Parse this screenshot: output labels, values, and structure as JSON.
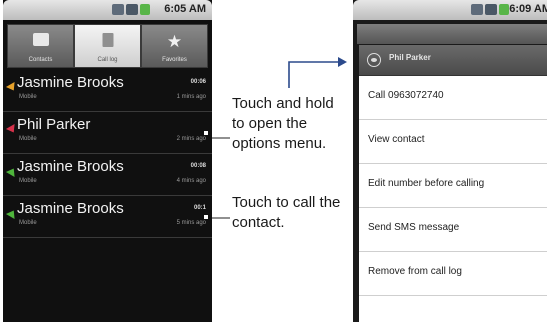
{
  "status": {
    "left_time": "6:05 AM",
    "right_time": "6:09 AM"
  },
  "tabs": [
    {
      "label": "Contacts",
      "icon": "contacts-icon"
    },
    {
      "label": "Call log",
      "icon": "call-log-icon"
    },
    {
      "label": "Favorites",
      "icon": "star-icon"
    }
  ],
  "calls": [
    {
      "name": "Jasmine Brooks",
      "type": "Mobile",
      "duration": "00:06",
      "ago": "1 mins ago",
      "indicator": "incoming"
    },
    {
      "name": "Phil Parker",
      "type": "Mobile",
      "duration": "",
      "ago": "2 mins ago",
      "indicator": "missed"
    },
    {
      "name": "Jasmine Brooks",
      "type": "Mobile",
      "duration": "00:08",
      "ago": "4 mins ago",
      "indicator": "outgoing"
    },
    {
      "name": "Jasmine Brooks",
      "type": "Mobile",
      "duration": "00:1",
      "ago": "5 mins ago",
      "indicator": "outgoing"
    }
  ],
  "callouts": {
    "hold": "Touch and hold to open the options menu.",
    "tap": "Touch to call the contact."
  },
  "menu": {
    "title": "Phil Parker",
    "items": [
      "Call 0963072740",
      "View contact",
      "Edit number before calling",
      "Send SMS message",
      "Remove from call log"
    ]
  }
}
